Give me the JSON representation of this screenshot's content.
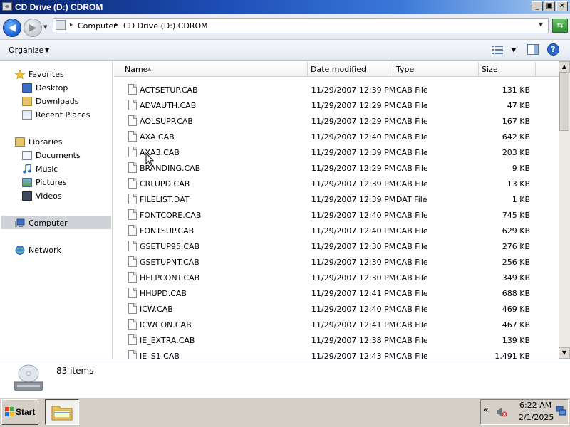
{
  "window": {
    "title": "CD Drive (D:) CDROM",
    "buttons": {
      "minimize": "_",
      "maximize": "▣",
      "close": "✕"
    }
  },
  "address": {
    "crumbs": [
      "Computer",
      "CD Drive (D:) CDROM"
    ]
  },
  "toolbar": {
    "organize": "Organize"
  },
  "nav": {
    "favorites": "Favorites",
    "desktop": "Desktop",
    "downloads": "Downloads",
    "recent_places": "Recent Places",
    "libraries": "Libraries",
    "documents": "Documents",
    "music": "Music",
    "pictures": "Pictures",
    "videos": "Videos",
    "computer": "Computer",
    "network": "Network"
  },
  "columns": {
    "name": "Name",
    "date": "Date modified",
    "type": "Type",
    "size": "Size"
  },
  "files": [
    {
      "name": "ACTSETUP.CAB",
      "date": "11/29/2007 12:39 PM",
      "type": "CAB File",
      "size": "131 KB"
    },
    {
      "name": "ADVAUTH.CAB",
      "date": "11/29/2007 12:29 PM",
      "type": "CAB File",
      "size": "47 KB"
    },
    {
      "name": "AOLSUPP.CAB",
      "date": "11/29/2007 12:29 PM",
      "type": "CAB File",
      "size": "167 KB"
    },
    {
      "name": "AXA.CAB",
      "date": "11/29/2007 12:40 PM",
      "type": "CAB File",
      "size": "642 KB"
    },
    {
      "name": "AXA3.CAB",
      "date": "11/29/2007 12:39 PM",
      "type": "CAB File",
      "size": "203 KB"
    },
    {
      "name": "BRANDING.CAB",
      "date": "11/29/2007 12:29 PM",
      "type": "CAB File",
      "size": "9 KB"
    },
    {
      "name": "CRLUPD.CAB",
      "date": "11/29/2007 12:39 PM",
      "type": "CAB File",
      "size": "13 KB"
    },
    {
      "name": "FILELIST.DAT",
      "date": "11/29/2007 12:39 PM",
      "type": "DAT File",
      "size": "1 KB"
    },
    {
      "name": "FONTCORE.CAB",
      "date": "11/29/2007 12:40 PM",
      "type": "CAB File",
      "size": "745 KB"
    },
    {
      "name": "FONTSUP.CAB",
      "date": "11/29/2007 12:40 PM",
      "type": "CAB File",
      "size": "629 KB"
    },
    {
      "name": "GSETUP95.CAB",
      "date": "11/29/2007 12:30 PM",
      "type": "CAB File",
      "size": "276 KB"
    },
    {
      "name": "GSETUPNT.CAB",
      "date": "11/29/2007 12:30 PM",
      "type": "CAB File",
      "size": "256 KB"
    },
    {
      "name": "HELPCONT.CAB",
      "date": "11/29/2007 12:30 PM",
      "type": "CAB File",
      "size": "349 KB"
    },
    {
      "name": "HHUPD.CAB",
      "date": "11/29/2007 12:41 PM",
      "type": "CAB File",
      "size": "688 KB"
    },
    {
      "name": "ICW.CAB",
      "date": "11/29/2007 12:40 PM",
      "type": "CAB File",
      "size": "469 KB"
    },
    {
      "name": "ICWCON.CAB",
      "date": "11/29/2007 12:41 PM",
      "type": "CAB File",
      "size": "467 KB"
    },
    {
      "name": "IE_EXTRA.CAB",
      "date": "11/29/2007 12:38 PM",
      "type": "CAB File",
      "size": "139 KB"
    },
    {
      "name": "IE_S1.CAB",
      "date": "11/29/2007 12:43 PM",
      "type": "CAB File",
      "size": "1,491 KB"
    }
  ],
  "details": {
    "item_count": "83 items"
  },
  "taskbar": {
    "start": "Start",
    "tray_chevron": "«",
    "time": "6:22 AM",
    "date": "2/1/2025"
  },
  "colors": {
    "title_bar": "#0a246a",
    "selection": "#cfd2d6",
    "taskbar": "#d4d0c8"
  }
}
